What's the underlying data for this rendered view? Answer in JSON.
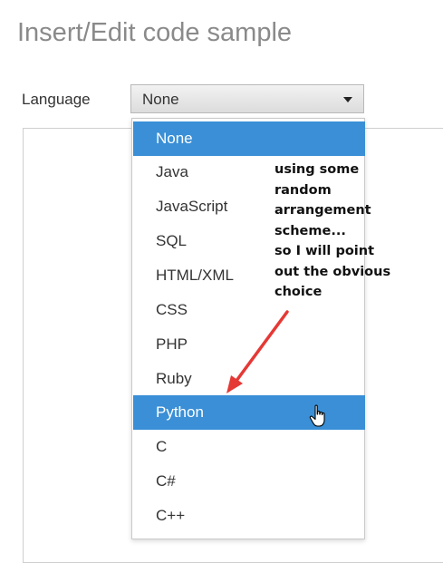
{
  "dialog": {
    "title": "Insert/Edit code sample"
  },
  "language": {
    "label": "Language",
    "selected": "None",
    "options": [
      "None",
      "Java",
      "JavaScript",
      "SQL",
      "HTML/XML",
      "CSS",
      "PHP",
      "Ruby",
      "Python",
      "C",
      "C#",
      "C++"
    ],
    "highlighted": [
      "None",
      "Python"
    ]
  },
  "annotation": {
    "lines": [
      "using some",
      "random",
      "arrangement",
      "scheme...",
      "so I will point",
      "out the obvious",
      "choice"
    ],
    "arrow_color": "#e53935"
  },
  "colors": {
    "highlight": "#3a8fd6",
    "title": "#8a8a8a"
  },
  "icons": {
    "cursor": "hand-pointer-icon",
    "caret": "caret-down-icon"
  }
}
